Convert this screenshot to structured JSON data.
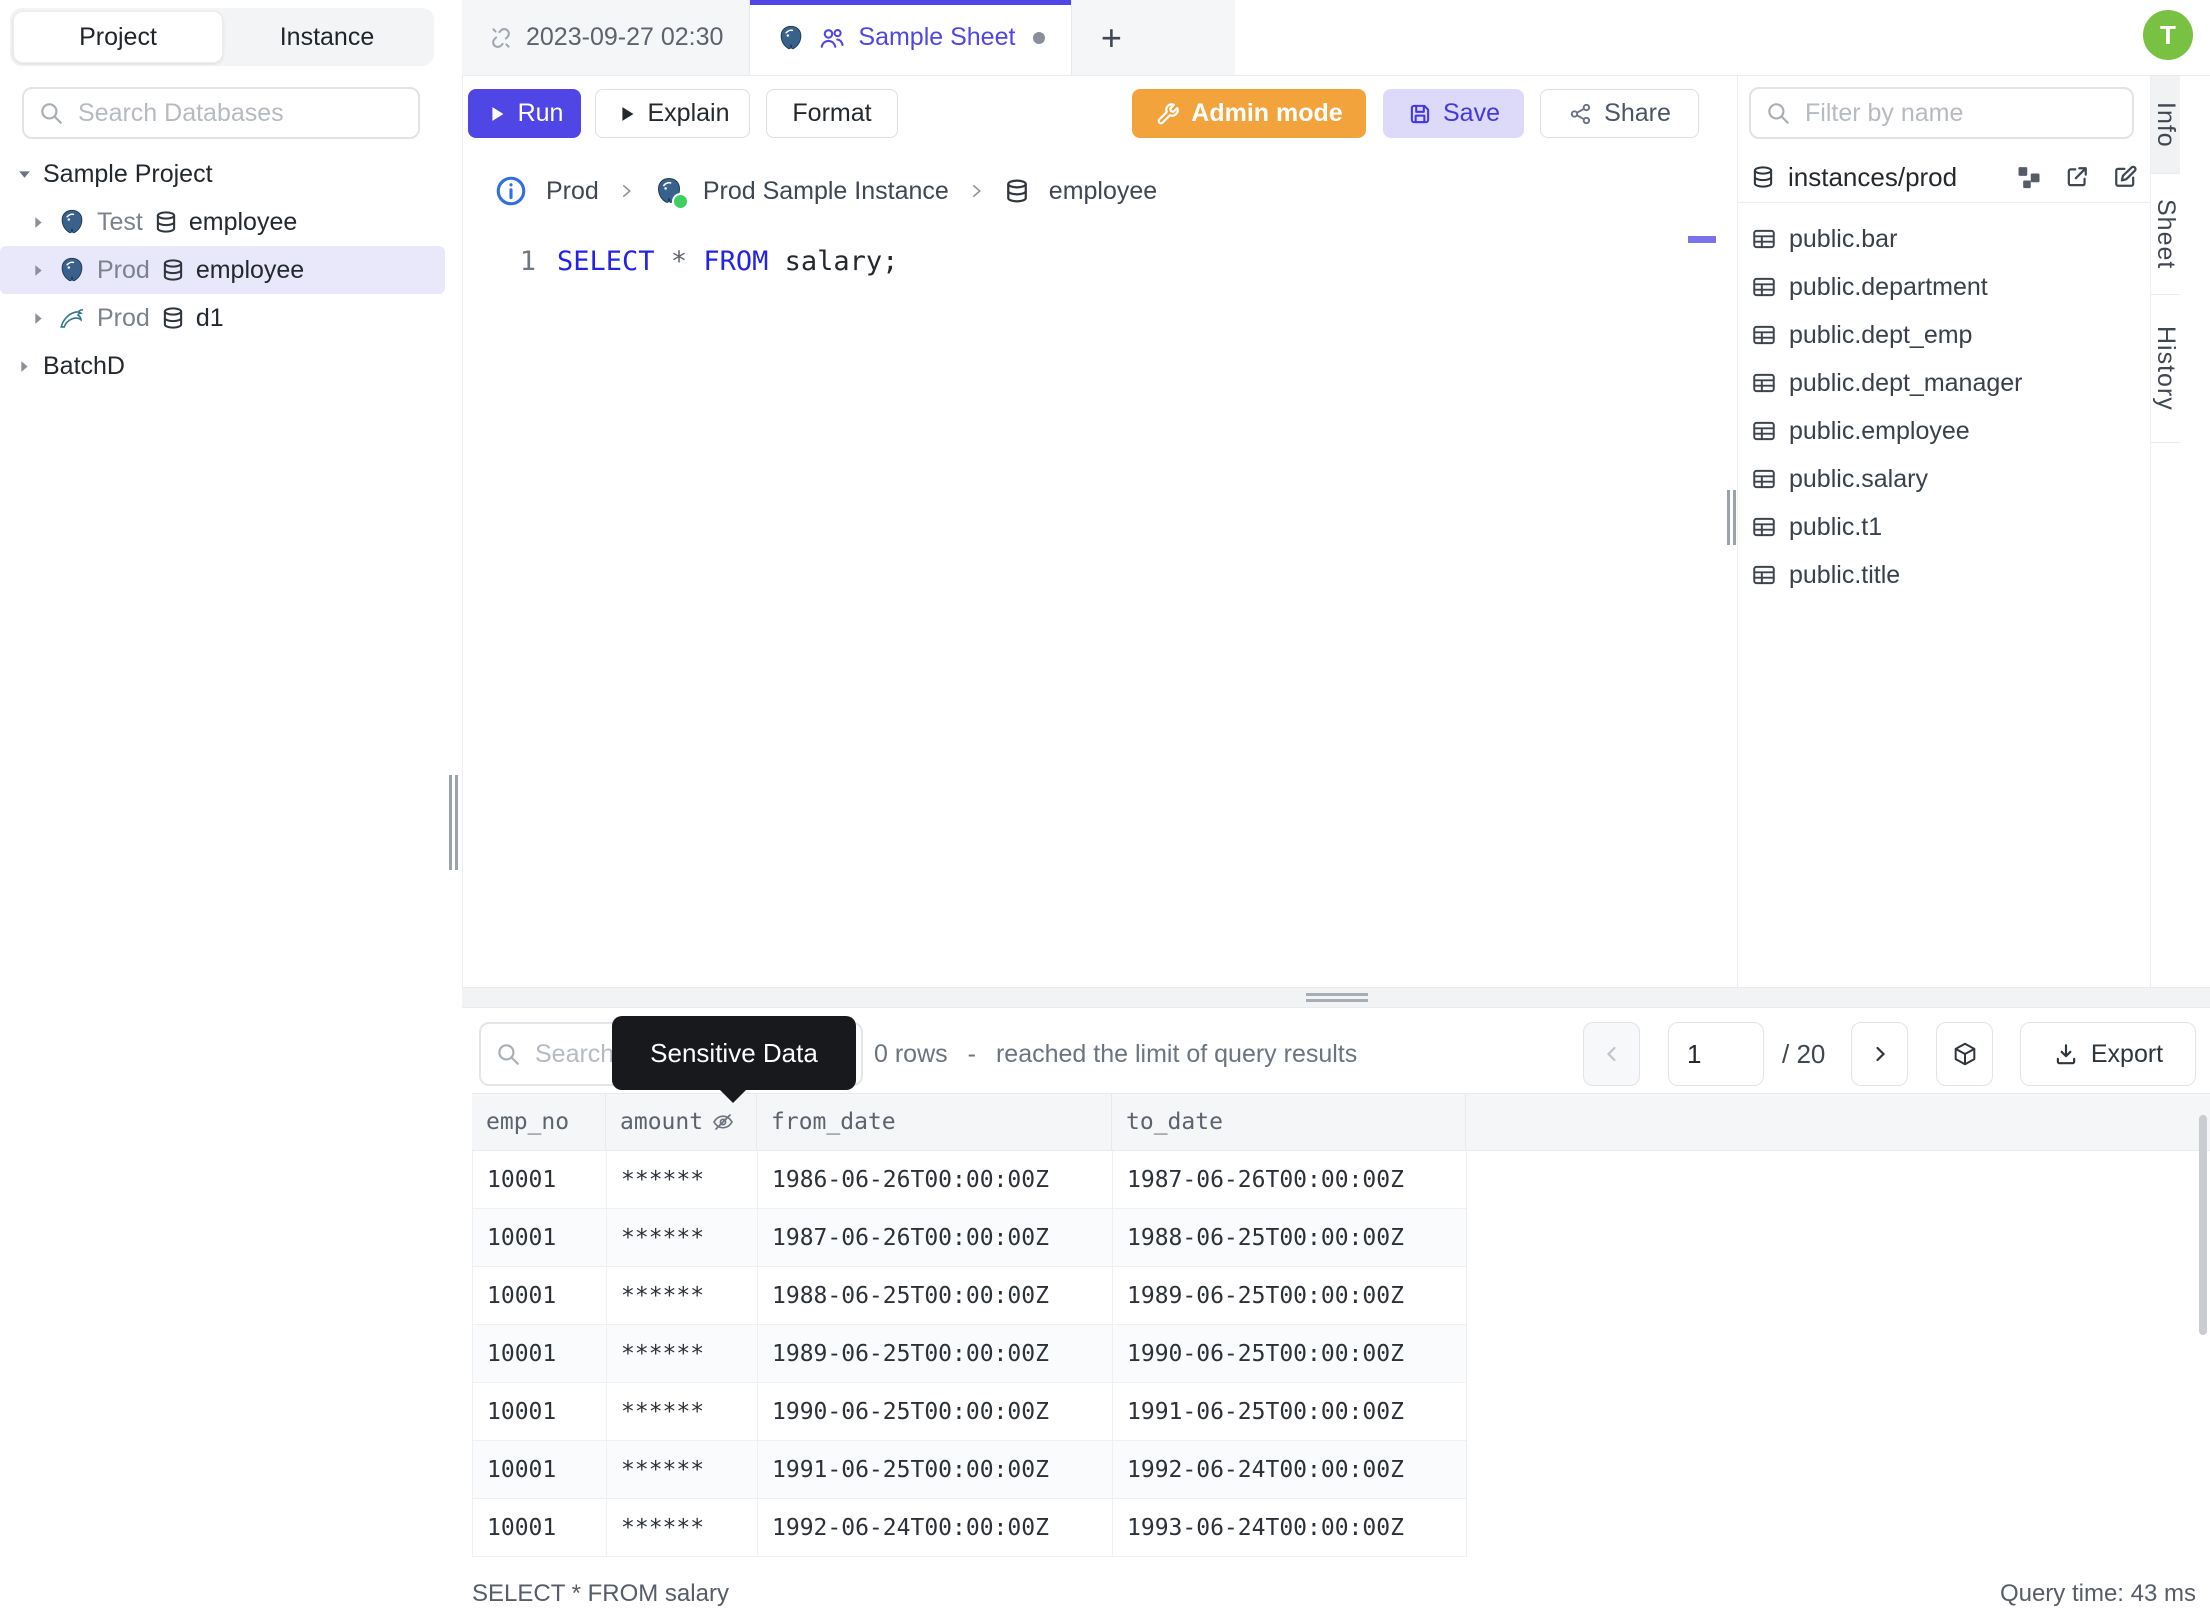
{
  "colors": {
    "accent": "#4f46e5",
    "admin_orange": "#f2a33c",
    "avatar_green": "#79c142",
    "keyword_blue": "#2323e5",
    "selected_row_bg": "#e9e8fb"
  },
  "sidebar": {
    "tabs": [
      {
        "label": "Project"
      },
      {
        "label": "Instance"
      }
    ],
    "search_placeholder": "Search Databases",
    "tree": [
      {
        "kind": "project",
        "caret": "down",
        "label": "Sample Project"
      },
      {
        "kind": "database",
        "caret": "right",
        "engine": "postgres",
        "env": "Test",
        "db": "employee",
        "selected": false
      },
      {
        "kind": "database",
        "caret": "right",
        "engine": "postgres",
        "env": "Prod",
        "db": "employee",
        "selected": true
      },
      {
        "kind": "database",
        "caret": "right",
        "engine": "mysql",
        "env": "Prod",
        "db": "d1",
        "selected": false
      },
      {
        "kind": "project",
        "caret": "right",
        "label": "BatchD"
      }
    ]
  },
  "tabbar": {
    "tab1_label": "2023-09-27 02:30",
    "tab2_label": "Sample Sheet",
    "add_label": "+",
    "avatar_initial": "T"
  },
  "toolbar": {
    "run": "Run",
    "explain": "Explain",
    "format": "Format",
    "admin": "Admin mode",
    "save": "Save",
    "share": "Share"
  },
  "breadcrumb": {
    "environment": "Prod",
    "instance": "Prod Sample Instance",
    "database": "employee"
  },
  "editor": {
    "line_number": "1",
    "tokens": [
      {
        "t": "SELECT",
        "c": "keyword"
      },
      {
        "t": " ",
        "c": "plain"
      },
      {
        "t": "*",
        "c": "operator"
      },
      {
        "t": " ",
        "c": "plain"
      },
      {
        "t": "FROM",
        "c": "keyword"
      },
      {
        "t": " salary;",
        "c": "plain"
      }
    ]
  },
  "schema_panel": {
    "filter_placeholder": "Filter by name",
    "path": "instances/prod",
    "tables": [
      "public.bar",
      "public.department",
      "public.dept_emp",
      "public.dept_manager",
      "public.employee",
      "public.salary",
      "public.t1",
      "public.title"
    ]
  },
  "side_tabs": [
    {
      "label": "Info",
      "active": true
    },
    {
      "label": "Sheet",
      "active": false
    },
    {
      "label": "History",
      "active": false
    }
  ],
  "results": {
    "search_placeholder": "Search",
    "tooltip": "Sensitive Data",
    "rows_info": "0 rows",
    "separator": "-",
    "limit_note": "reached the limit of query results",
    "page": "1",
    "page_total": "/ 20",
    "export_label": "Export",
    "table": {
      "columns": [
        "emp_no",
        "amount",
        "from_date",
        "to_date"
      ],
      "masked_column": "amount",
      "rows": [
        [
          "10001",
          "******",
          "1986-06-26T00:00:00Z",
          "1987-06-26T00:00:00Z"
        ],
        [
          "10001",
          "******",
          "1987-06-26T00:00:00Z",
          "1988-06-25T00:00:00Z"
        ],
        [
          "10001",
          "******",
          "1988-06-25T00:00:00Z",
          "1989-06-25T00:00:00Z"
        ],
        [
          "10001",
          "******",
          "1989-06-25T00:00:00Z",
          "1990-06-25T00:00:00Z"
        ],
        [
          "10001",
          "******",
          "1990-06-25T00:00:00Z",
          "1991-06-25T00:00:00Z"
        ],
        [
          "10001",
          "******",
          "1991-06-25T00:00:00Z",
          "1992-06-24T00:00:00Z"
        ],
        [
          "10001",
          "******",
          "1992-06-24T00:00:00Z",
          "1993-06-24T00:00:00Z"
        ]
      ]
    },
    "status_query": "SELECT * FROM salary",
    "query_time": "Query time: 43 ms"
  }
}
